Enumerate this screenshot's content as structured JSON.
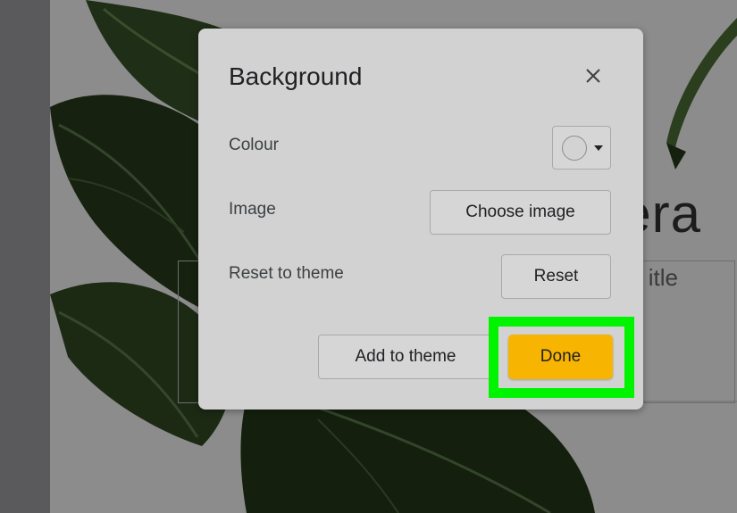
{
  "background": {
    "slide_title_partial": "era",
    "slide_subtitle_partial": "itle"
  },
  "dialog": {
    "title": "Background",
    "close_icon": "close-icon",
    "rows": {
      "colour_label": "Colour",
      "image_label": "Image",
      "reset_label": "Reset to theme"
    },
    "buttons": {
      "choose_image": "Choose image",
      "reset": "Reset",
      "add_to_theme": "Add to theme",
      "done": "Done"
    },
    "colour_picker": {
      "selected_colour": "#d3d3d3",
      "dropdown_icon": "caret-down-icon"
    }
  },
  "colors": {
    "done_accent": "#f7b400",
    "highlight": "#00f400",
    "dialog_bg": "#d2d2d2"
  }
}
